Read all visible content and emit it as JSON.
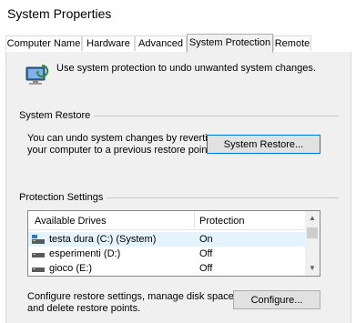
{
  "window": {
    "title": "System Properties"
  },
  "tabs": [
    {
      "label": "Computer Name",
      "active": false
    },
    {
      "label": "Hardware",
      "active": false
    },
    {
      "label": "Advanced",
      "active": false
    },
    {
      "label": "System Protection",
      "active": true
    },
    {
      "label": "Remote",
      "active": false
    }
  ],
  "intro": {
    "text": "Use system protection to undo unwanted system changes."
  },
  "system_restore": {
    "group_label": "System Restore",
    "line1": "You can undo system changes by reverting",
    "line2": "your computer to a previous restore point.",
    "button": "System Restore..."
  },
  "protection": {
    "group_label": "Protection Settings",
    "columns": {
      "drive": "Available Drives",
      "status": "Protection"
    },
    "drives": [
      {
        "name": "testa dura (C:) (System)",
        "status": "On",
        "system": true
      },
      {
        "name": "esperimenti (D:)",
        "status": "Off",
        "system": false
      },
      {
        "name": "gioco (E:)",
        "status": "Off",
        "system": false
      }
    ],
    "configure_line1": "Configure restore settings, manage disk space,",
    "configure_line2": "and delete restore points.",
    "configure_button": "Configure..."
  },
  "colors": {
    "accent": "#0078d7",
    "selection": "#e5f3ff",
    "panel": "#f0f0f0"
  }
}
